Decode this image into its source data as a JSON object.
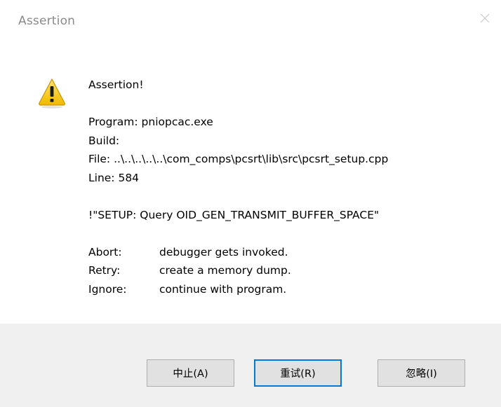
{
  "window": {
    "title": "Assertion",
    "close_icon": "close-icon"
  },
  "icon": {
    "name": "warning-icon",
    "color": "#f5c400"
  },
  "message": {
    "heading": "Assertion!",
    "program": "Program: pniopcac.exe",
    "build": "Build:",
    "file": "File: ..\\..\\..\\..\\..\\com_comps\\pcsrt\\lib\\src\\pcsrt_setup.cpp",
    "line": "Line: 584",
    "expression": "!\"SETUP: Query OID_GEN_TRANSMIT_BUFFER_SPACE\"",
    "options": [
      {
        "key": "Abort:",
        "desc": "debugger gets invoked."
      },
      {
        "key": "Retry:",
        "desc": "create a memory dump."
      },
      {
        "key": "Ignore:",
        "desc": "continue with program."
      }
    ]
  },
  "buttons": {
    "abort": "中止(A)",
    "retry": "重试(R)",
    "ignore": "忽略(I)"
  },
  "colors": {
    "button_area_bg": "#f0f0f0",
    "focus_border": "#0078d7",
    "title_text": "#8a8a8a"
  }
}
